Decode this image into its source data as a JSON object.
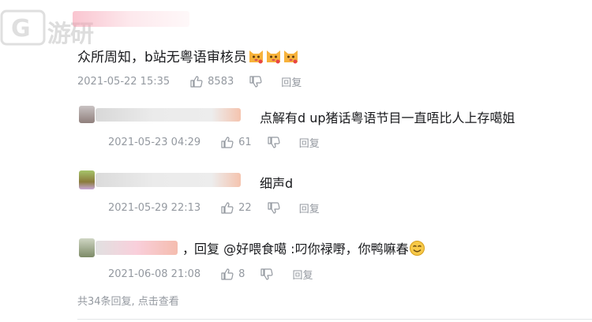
{
  "watermark": {
    "text": "游研"
  },
  "comment": {
    "text": "众所周知，b站无粤语审核员",
    "time": "2021-05-22 15:35",
    "likes": "8583",
    "reply_label": "回复"
  },
  "replies": [
    {
      "text": "点解有d up猪话粤语节目一直唔比人上存噶姐",
      "time": "2021-05-23 04:29",
      "likes": "61",
      "reply_label": "回复"
    },
    {
      "text": "细声d",
      "time": "2021-05-29 22:13",
      "likes": "22",
      "reply_label": "回复"
    },
    {
      "text_prefix": "，",
      "text": "回复 @好喂食噶 :叼你禄嘢，你鸭嘛春",
      "time": "2021-06-08 21:08",
      "likes": "8",
      "reply_label": "回复"
    }
  ],
  "more_replies": "共34条回复, 点击查看",
  "colors": {
    "meta": "#9499a0",
    "text": "#18191c"
  },
  "icons": {
    "like": "thumb-up-icon",
    "dislike": "thumb-down-icon",
    "emoji": "cat-emoji-icon",
    "smile": "smile-emoji-icon"
  }
}
